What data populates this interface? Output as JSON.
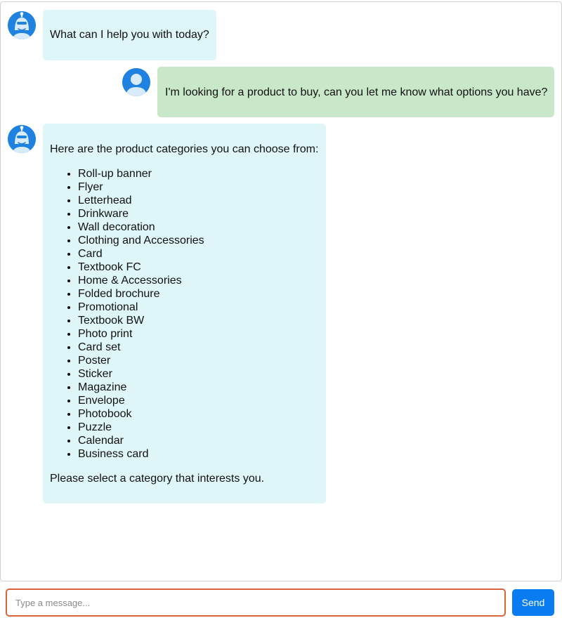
{
  "chat": {
    "messages": [
      {
        "sender": "bot",
        "avatar_icon": "robot-icon",
        "text": "What can I help you with today?"
      },
      {
        "sender": "user",
        "avatar_icon": "user-icon",
        "text": "I'm looking for a product to buy, can you let me know what options you have?"
      },
      {
        "sender": "bot",
        "avatar_icon": "robot-icon",
        "intro": "Here are the product categories you can choose from:",
        "categories": [
          "Roll-up banner",
          "Flyer",
          "Letterhead",
          "Drinkware",
          "Wall decoration",
          "Clothing and Accessories",
          "Card",
          "Textbook FC",
          "Home & Accessories",
          "Folded brochure",
          "Promotional",
          "Textbook BW",
          "Photo print",
          "Card set",
          "Poster",
          "Sticker",
          "Magazine",
          "Envelope",
          "Photobook",
          "Puzzle",
          "Calendar",
          "Business card"
        ],
        "outro": "Please select a category that interests you."
      }
    ]
  },
  "composer": {
    "input_value": "",
    "placeholder": "Type a message...",
    "send_label": "Send"
  },
  "colors": {
    "bot_bubble": "#dff6f8",
    "user_bubble": "#c9e7c9",
    "avatar": "#1f82e0",
    "send_button": "#0a7cf2",
    "input_border_focus": "#d9633a"
  }
}
